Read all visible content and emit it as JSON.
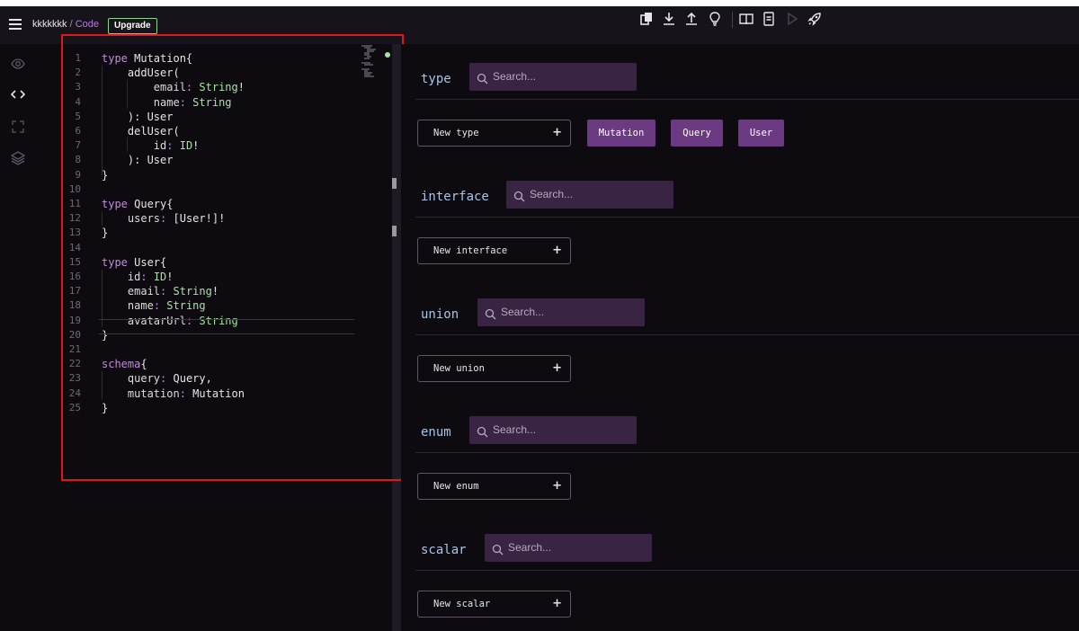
{
  "header": {
    "project_name": "kkkkkkk",
    "separator": "/",
    "mode": "Code",
    "upgrade_label": "Upgrade"
  },
  "toolbar_icons": [
    "copy-icon",
    "download-icon",
    "upload-icon",
    "lightbulb-icon",
    "book-icon",
    "document-icon",
    "play-icon",
    "rocket-icon"
  ],
  "left_rail_icons": [
    "eye-icon",
    "code-icon",
    "expand-icon",
    "layers-icon"
  ],
  "editor": {
    "lines": [
      {
        "n": "1",
        "text": "type Mutation{"
      },
      {
        "n": "2",
        "text": "    addUser("
      },
      {
        "n": "3",
        "text": "        email: String!"
      },
      {
        "n": "4",
        "text": "        name: String"
      },
      {
        "n": "5",
        "text": "    ): User"
      },
      {
        "n": "6",
        "text": "    delUser("
      },
      {
        "n": "7",
        "text": "        id: ID!"
      },
      {
        "n": "8",
        "text": "    ): User"
      },
      {
        "n": "9",
        "text": "}"
      },
      {
        "n": "10",
        "text": ""
      },
      {
        "n": "11",
        "text": "type Query{"
      },
      {
        "n": "12",
        "text": "    users: [User!]!"
      },
      {
        "n": "13",
        "text": "}"
      },
      {
        "n": "14",
        "text": ""
      },
      {
        "n": "15",
        "text": "type User{"
      },
      {
        "n": "16",
        "text": "    id: ID!"
      },
      {
        "n": "17",
        "text": "    email: String!"
      },
      {
        "n": "18",
        "text": "    name: String"
      },
      {
        "n": "19",
        "text": "    avatarUrl: String"
      },
      {
        "n": "20",
        "text": "}"
      },
      {
        "n": "21",
        "text": ""
      },
      {
        "n": "22",
        "text": "schema{"
      },
      {
        "n": "23",
        "text": "    query: Query,"
      },
      {
        "n": "24",
        "text": "    mutation: Mutation"
      },
      {
        "n": "25",
        "text": "}"
      }
    ]
  },
  "sections": {
    "type": {
      "label": "type",
      "search_placeholder": "Search...",
      "new_label": "New type",
      "chips": [
        "Mutation",
        "Query",
        "User"
      ]
    },
    "interface": {
      "label": "interface",
      "search_placeholder": "Search...",
      "new_label": "New interface"
    },
    "union": {
      "label": "union",
      "search_placeholder": "Search...",
      "new_label": "New union"
    },
    "enum": {
      "label": "enum",
      "search_placeholder": "Search...",
      "new_label": "New enum"
    },
    "scalar": {
      "label": "scalar",
      "search_placeholder": "Search...",
      "new_label": "New scalar"
    }
  },
  "colors": {
    "keyword": "#c58ae0",
    "type": "#a6e2a3",
    "chip": "#6b3a82",
    "search_bg": "#3a2444",
    "highlight_border": "#e0161b"
  }
}
